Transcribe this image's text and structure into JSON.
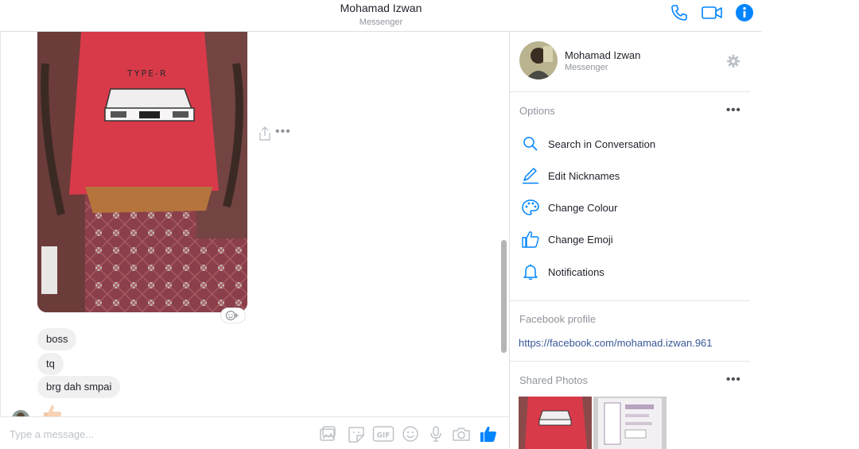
{
  "header": {
    "title": "Mohamad Izwan",
    "subtitle": "Messenger",
    "icons": [
      "phone-icon",
      "video-camera-icon",
      "info-icon"
    ],
    "accent": "#0084ff"
  },
  "chat": {
    "photo_label": "TYPE-R",
    "messages": [
      {
        "text": "boss"
      },
      {
        "text": "tq"
      },
      {
        "text": "brg dah smpai"
      }
    ],
    "bubble_color": "#f1f0f0"
  },
  "composer": {
    "placeholder": "Type a message...",
    "gif_label": "GIF"
  },
  "panel": {
    "name": "Mohamad Izwan",
    "subtitle": "Messenger",
    "options_title": "Options",
    "options": [
      {
        "label": "Search in Conversation",
        "icon": "search-icon"
      },
      {
        "label": "Edit Nicknames",
        "icon": "pencil-icon"
      },
      {
        "label": "Change Colour",
        "icon": "palette-icon"
      },
      {
        "label": "Change Emoji",
        "icon": "thumbs-up-icon"
      },
      {
        "label": "Notifications",
        "icon": "bell-icon"
      }
    ],
    "fb_profile_title": "Facebook profile",
    "fb_profile_url": "https://facebook.com/mohamad.izwan.961",
    "shared_photos_title": "Shared Photos"
  }
}
